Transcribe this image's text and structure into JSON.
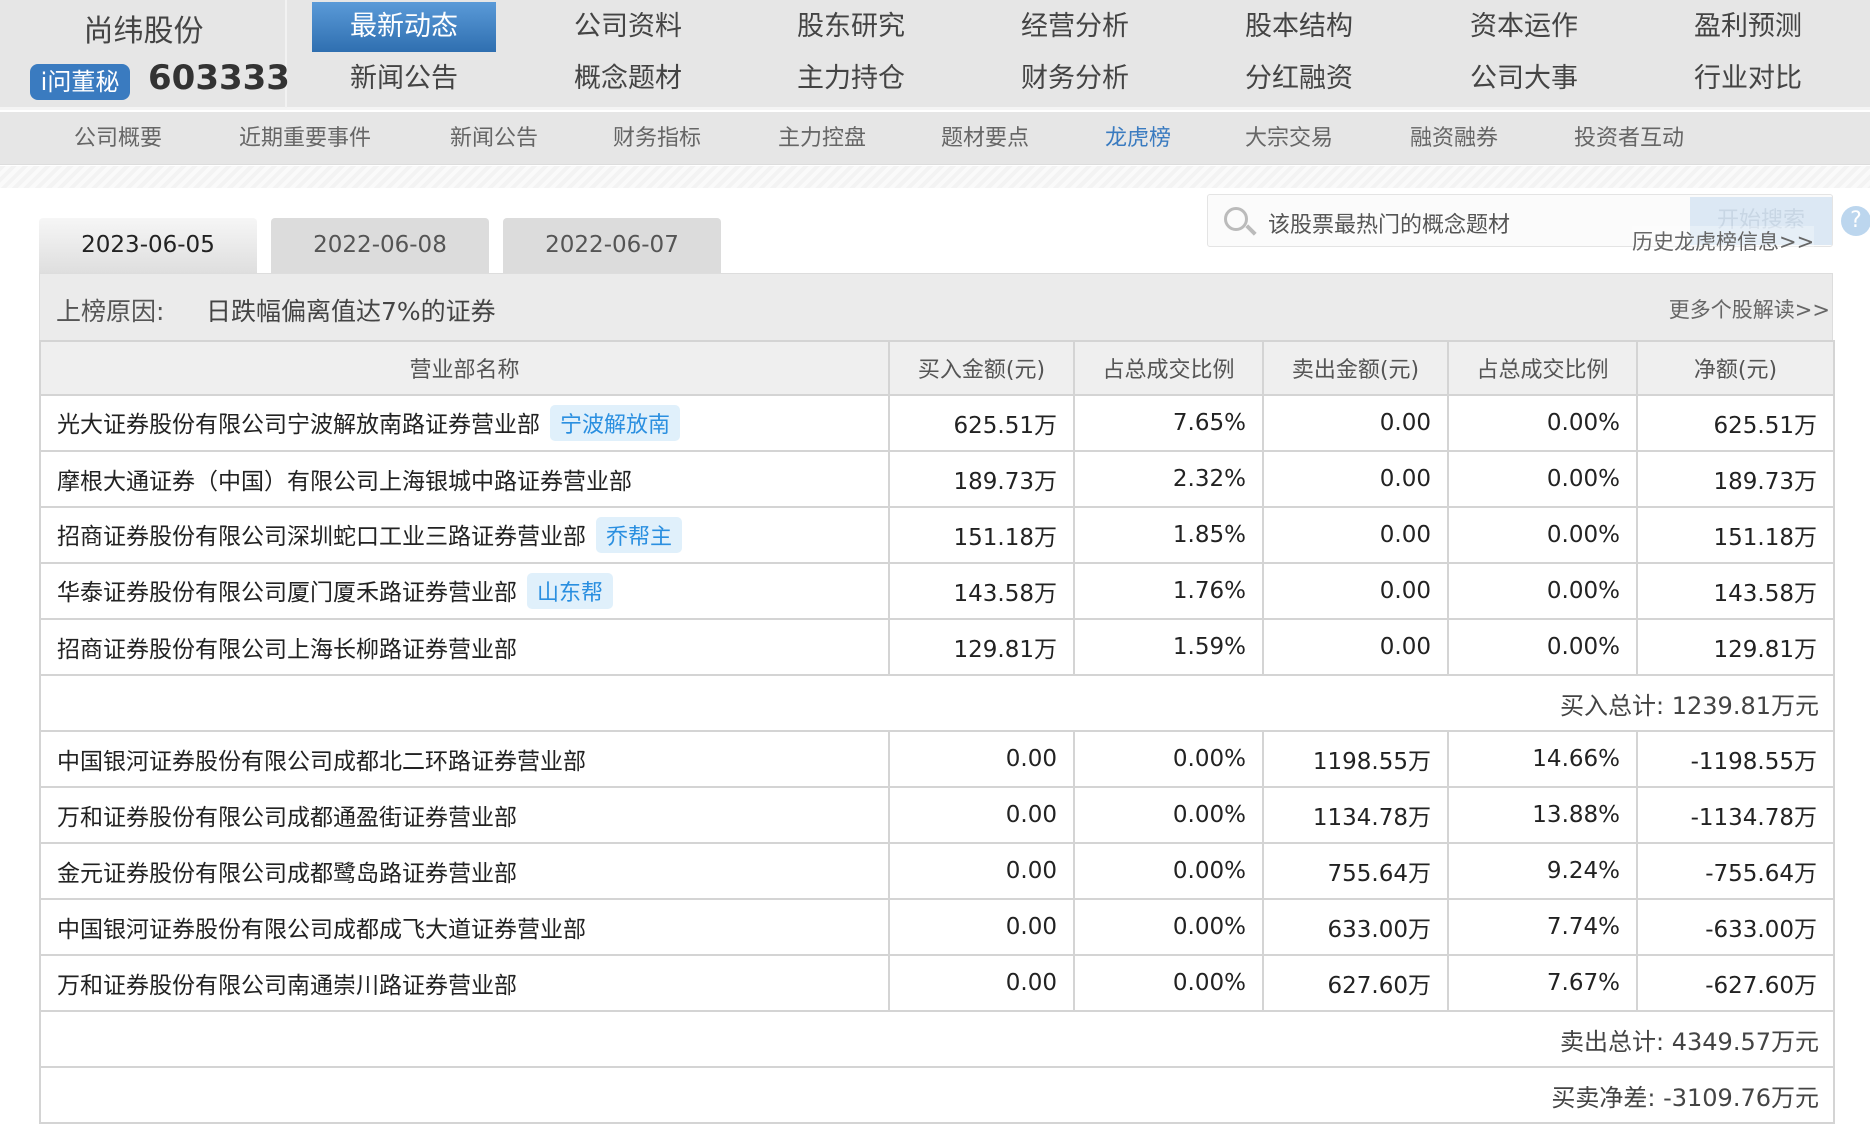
{
  "header": {
    "company": "尚纬股份",
    "badge": "i问董秘",
    "code": "603333",
    "nav": [
      [
        "最新动态",
        "新闻公告"
      ],
      [
        "公司资料",
        "概念题材"
      ],
      [
        "股东研究",
        "主力持仓"
      ],
      [
        "经营分析",
        "财务分析"
      ],
      [
        "股本结构",
        "分红融资"
      ],
      [
        "资本运作",
        "公司大事"
      ],
      [
        "盈利预测",
        "行业对比"
      ]
    ],
    "active_nav": "最新动态"
  },
  "subnav": {
    "items": [
      "公司概要",
      "近期重要事件",
      "新闻公告",
      "财务指标",
      "主力控盘",
      "题材要点",
      "龙虎榜",
      "大宗交易",
      "融资融券",
      "投资者互动"
    ],
    "active": "龙虎榜"
  },
  "tabs": [
    "2023-06-05",
    "2022-06-08",
    "2022-06-07"
  ],
  "search": {
    "placeholder": "该股票最热门的概念题材",
    "button": "开始搜索"
  },
  "history_link": "历史龙虎榜信息>>",
  "help": "?",
  "reason": {
    "label": "上榜原因:",
    "text": "日跌幅偏离值达7%的证券",
    "more": "更多个股解读>>"
  },
  "table": {
    "headers": [
      "营业部名称",
      "买入金额(元)",
      "占总成交比例",
      "卖出金额(元)",
      "占总成交比例",
      "净额(元)"
    ],
    "buy_rows": [
      {
        "name": "光大证券股份有限公司宁波解放南路证券营业部",
        "tag": "宁波解放南",
        "buy": "625.51万",
        "buy_pct": "7.65%",
        "sell": "0.00",
        "sell_pct": "0.00%",
        "net": "625.51万"
      },
      {
        "name": "摩根大通证券（中国）有限公司上海银城中路证券营业部",
        "tag": null,
        "buy": "189.73万",
        "buy_pct": "2.32%",
        "sell": "0.00",
        "sell_pct": "0.00%",
        "net": "189.73万"
      },
      {
        "name": "招商证券股份有限公司深圳蛇口工业三路证券营业部",
        "tag": "乔帮主",
        "buy": "151.18万",
        "buy_pct": "1.85%",
        "sell": "0.00",
        "sell_pct": "0.00%",
        "net": "151.18万"
      },
      {
        "name": "华泰证券股份有限公司厦门厦禾路证券营业部",
        "tag": "山东帮",
        "buy": "143.58万",
        "buy_pct": "1.76%",
        "sell": "0.00",
        "sell_pct": "0.00%",
        "net": "143.58万"
      },
      {
        "name": "招商证券股份有限公司上海长柳路证券营业部",
        "tag": null,
        "buy": "129.81万",
        "buy_pct": "1.59%",
        "sell": "0.00",
        "sell_pct": "0.00%",
        "net": "129.81万"
      }
    ],
    "buy_total": "买入总计:  1239.81万元",
    "sell_rows": [
      {
        "name": "中国银河证券股份有限公司成都北二环路证券营业部",
        "tag": null,
        "buy": "0.00",
        "buy_pct": "0.00%",
        "sell": "1198.55万",
        "sell_pct": "14.66%",
        "net": "-1198.55万"
      },
      {
        "name": "万和证券股份有限公司成都通盈街证券营业部",
        "tag": null,
        "buy": "0.00",
        "buy_pct": "0.00%",
        "sell": "1134.78万",
        "sell_pct": "13.88%",
        "net": "-1134.78万"
      },
      {
        "name": "金元证券股份有限公司成都鹭岛路证券营业部",
        "tag": null,
        "buy": "0.00",
        "buy_pct": "0.00%",
        "sell": "755.64万",
        "sell_pct": "9.24%",
        "net": "-755.64万"
      },
      {
        "name": "中国银河证券股份有限公司成都成飞大道证券营业部",
        "tag": null,
        "buy": "0.00",
        "buy_pct": "0.00%",
        "sell": "633.00万",
        "sell_pct": "7.74%",
        "net": "-633.00万"
      },
      {
        "name": "万和证券股份有限公司南通崇川路证券营业部",
        "tag": null,
        "buy": "0.00",
        "buy_pct": "0.00%",
        "sell": "627.60万",
        "sell_pct": "7.67%",
        "net": "-627.60万"
      }
    ],
    "sell_total": "卖出总计:  4349.57万元",
    "net_total": "买卖净差:  -3109.76万元"
  }
}
